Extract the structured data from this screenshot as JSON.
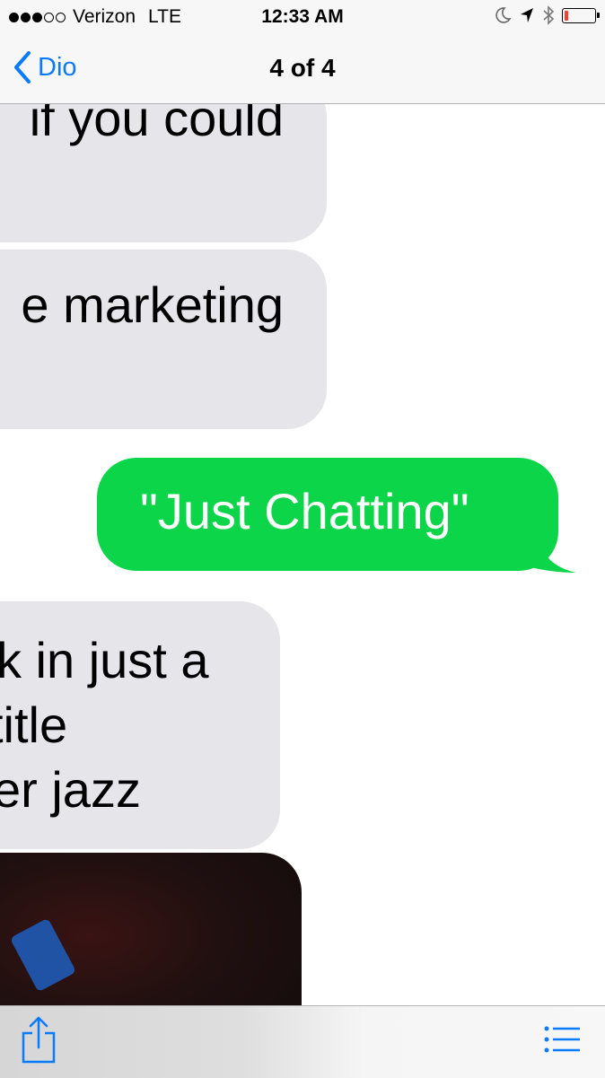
{
  "status_bar": {
    "carrier": "Verizon",
    "network": "LTE",
    "time": "12:33 AM",
    "signal_bars_filled": 3,
    "signal_bars_total": 5,
    "battery_level": 0.12,
    "battery_color": "#ff3b30"
  },
  "nav": {
    "back_label": "Dio",
    "title": "4 of 4",
    "accent_color": "#0a7aff"
  },
  "messages": [
    {
      "side": "received",
      "lines": [
        "if you could"
      ]
    },
    {
      "side": "received",
      "lines": [
        "e marketing"
      ]
    },
    {
      "side": "sent",
      "lines": [
        "\"Just Chatting\""
      ],
      "color": "#0dd54a"
    },
    {
      "side": "received",
      "lines": [
        "k in just a",
        "title",
        "er jazz"
      ]
    },
    {
      "side": "received",
      "type": "image"
    }
  ],
  "toolbar": {
    "share_icon": "share-icon",
    "list_icon": "list-icon"
  }
}
